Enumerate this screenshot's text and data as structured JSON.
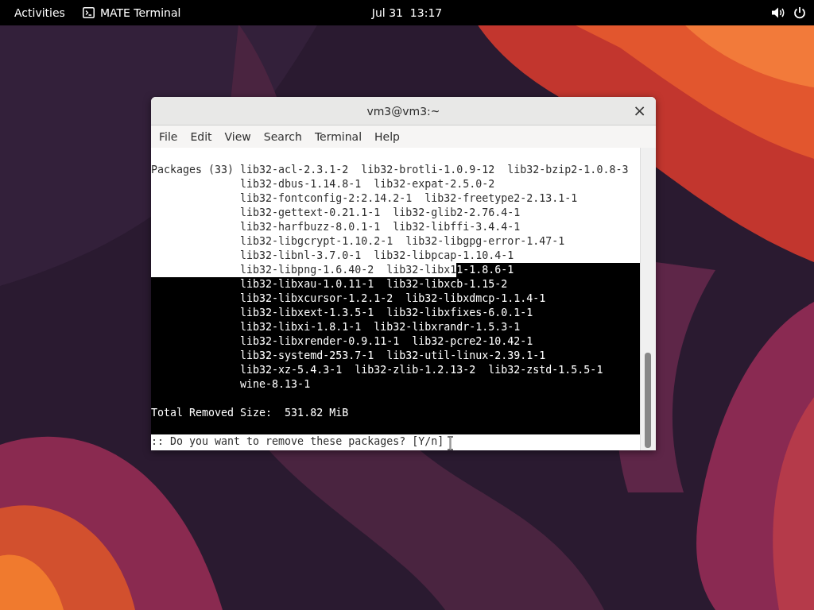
{
  "top_bar": {
    "activities": "Activities",
    "app_name": "MATE Terminal",
    "clock": "Jul 31  13:17"
  },
  "window": {
    "title": "vm3@vm3:~",
    "close": "×",
    "menu": [
      "File",
      "Edit",
      "View",
      "Search",
      "Terminal",
      "Help"
    ],
    "terminal": {
      "lines": [
        {
          "kind": "text",
          "segments": [
            {
              "text": "Packages (33) lib32-acl-2.3.1-2  lib32-brotli-1.0.9-12  lib32-bzip2-1.0.8-3",
              "selected": false
            }
          ]
        },
        {
          "kind": "text",
          "segments": [
            {
              "text": "              lib32-dbus-1.14.8-1  lib32-expat-2.5.0-2",
              "selected": false
            }
          ]
        },
        {
          "kind": "text",
          "segments": [
            {
              "text": "              lib32-fontconfig-2:2.14.2-1  lib32-freetype2-2.13.1-1",
              "selected": false
            }
          ]
        },
        {
          "kind": "text",
          "segments": [
            {
              "text": "              lib32-gettext-0.21.1-1  lib32-glib2-2.76.4-1",
              "selected": false
            }
          ]
        },
        {
          "kind": "text",
          "segments": [
            {
              "text": "              lib32-harfbuzz-8.0.1-1  lib32-libffi-3.4.4-1",
              "selected": false
            }
          ]
        },
        {
          "kind": "text",
          "segments": [
            {
              "text": "              lib32-libgcrypt-1.10.2-1  lib32-libgpg-error-1.47-1",
              "selected": false
            }
          ]
        },
        {
          "kind": "text",
          "segments": [
            {
              "text": "              lib32-libnl-3.7.0-1  lib32-libpcap-1.10.4-1",
              "selected": false
            }
          ]
        },
        {
          "kind": "text",
          "segments": [
            {
              "text": "              lib32-libpng-1.6.40-2  lib32-libx1",
              "selected": false
            },
            {
              "text": "1-1.8.6-1",
              "selected": true
            }
          ]
        },
        {
          "kind": "text",
          "segments": [
            {
              "text": "              lib32-libxau-1.0.11-1  lib32-libxcb-1.15-2",
              "selected": true
            }
          ]
        },
        {
          "kind": "text",
          "segments": [
            {
              "text": "              lib32-libxcursor-1.2.1-2  lib32-libxdmcp-1.1.4-1",
              "selected": true
            }
          ]
        },
        {
          "kind": "text",
          "segments": [
            {
              "text": "              lib32-libxext-1.3.5-1  lib32-libxfixes-6.0.1-1",
              "selected": true
            }
          ]
        },
        {
          "kind": "text",
          "segments": [
            {
              "text": "              lib32-libxi-1.8.1-1  lib32-libxrandr-1.5.3-1",
              "selected": true
            }
          ]
        },
        {
          "kind": "text",
          "segments": [
            {
              "text": "              lib32-libxrender-0.9.11-1  lib32-pcre2-10.42-1",
              "selected": true
            }
          ]
        },
        {
          "kind": "text",
          "segments": [
            {
              "text": "              lib32-systemd-253.7-1  lib32-util-linux-2.39.1-1",
              "selected": true
            }
          ]
        },
        {
          "kind": "text",
          "segments": [
            {
              "text": "              lib32-xz-5.4.3-1  lib32-zlib-1.2.13-2  lib32-zstd-1.5.5-1",
              "selected": true
            }
          ]
        },
        {
          "kind": "text",
          "segments": [
            {
              "text": "              wine-8.13-1",
              "selected": true
            }
          ]
        },
        {
          "kind": "blank",
          "selected": true
        },
        {
          "kind": "text",
          "segments": [
            {
              "text": "Total Removed Size:  531.82 MiB",
              "selected": true
            }
          ]
        },
        {
          "kind": "blank",
          "selected": true
        },
        {
          "kind": "text",
          "segments": [
            {
              "text": ":: Do you want to remove these packages? [Y/n]",
              "selected": false
            }
          ]
        }
      ]
    }
  }
}
